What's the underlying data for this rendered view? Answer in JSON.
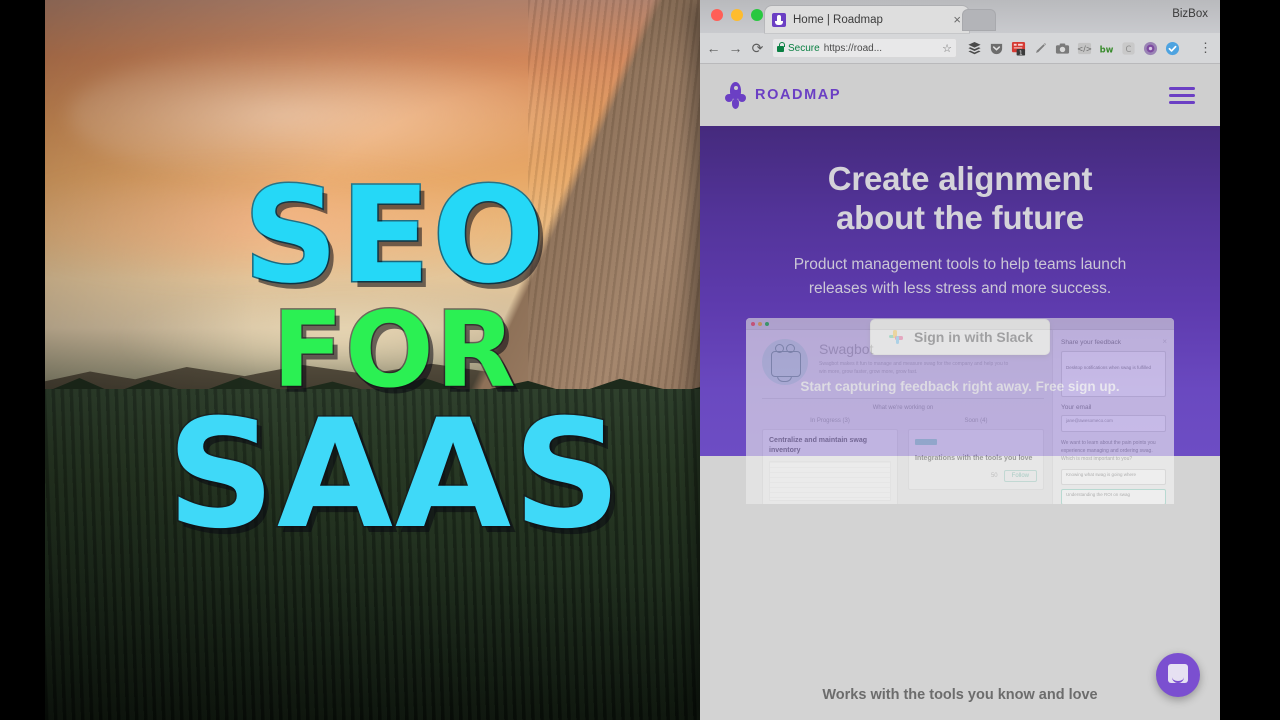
{
  "video_thumbnail": {
    "lines": [
      {
        "text": "SEO",
        "color": "#25d8f7"
      },
      {
        "text": "FOR",
        "color": "#2bf053"
      },
      {
        "text": "SAAS",
        "color": "#3fd9f8"
      }
    ]
  },
  "browser": {
    "window_title": "BizBox",
    "tab": {
      "title": "Home | Roadmap",
      "close_label": "×",
      "favicon_name": "rocket-favicon"
    },
    "toolbar": {
      "back": "←",
      "forward": "→",
      "reload": "⟳",
      "security_label": "Secure",
      "url": "https://road...",
      "bookmark_star": "☆",
      "menu": "⋮",
      "extensions": [
        {
          "name": "buffer-extension-icon",
          "glyph": "☰"
        },
        {
          "name": "pocket-extension-icon",
          "glyph": "▼"
        },
        {
          "name": "notification-extension-icon",
          "badge": "1"
        },
        {
          "name": "highlighter-extension-icon",
          "glyph": "╱"
        },
        {
          "name": "screenshot-camera-extension-icon",
          "glyph": "▣"
        },
        {
          "name": "code-inspector-extension-icon",
          "glyph": "</>"
        },
        {
          "name": "bw-extension-icon",
          "glyph": "bw"
        },
        {
          "name": "c-extension-icon",
          "glyph": "C"
        },
        {
          "name": "circle-purple-extension-icon",
          "glyph": "◉"
        },
        {
          "name": "check-blue-extension-icon",
          "glyph": "✓"
        }
      ]
    }
  },
  "site": {
    "nav": {
      "brand": "ROADMAP",
      "menu_label": "≡"
    },
    "hero": {
      "heading_line1": "Create alignment",
      "heading_line2": "about the future",
      "subheading": "Product management tools to help teams launch releases with less stress and more success.",
      "cta_label": "Sign in with Slack",
      "free_signup": "Start capturing feedback right away. Free sign up.",
      "bg_gradient_top": "#452a7d",
      "bg_gradient_bottom": "#6d4dc4",
      "brand_color": "#6b3fc4"
    },
    "product_screenshot": {
      "bot_name": "Swagbot",
      "bot_description": "Swagbot makes it fun to manage and measure swag for the company and help you to win more, grow faster, grow more, grow fast.",
      "section_title": "What we're working on",
      "columns": [
        {
          "header": "In Progress (3)",
          "card_title": "Centralize and maintain swag inventory"
        },
        {
          "header": "Soon (4)",
          "card_title": "Integrations with the tools you love",
          "votes": "50",
          "follow_label": "Follow"
        }
      ],
      "feedback_panel": {
        "title": "Share your feedback",
        "close": "×",
        "message": "Desktop notifications when swag is fulfilled",
        "email_label": "Your email",
        "email_value": "jane@awesomeco.com",
        "question": "We want to learn about the pain points you experience managing and ordering swag. Which is most important to you?",
        "options": [
          "Knowing what swag is going where",
          "Understanding the ROI on swag"
        ]
      }
    },
    "footer": {
      "heading": "Works with the tools you know and love"
    },
    "chat_widget": {
      "name": "intercom-chat-button"
    }
  }
}
